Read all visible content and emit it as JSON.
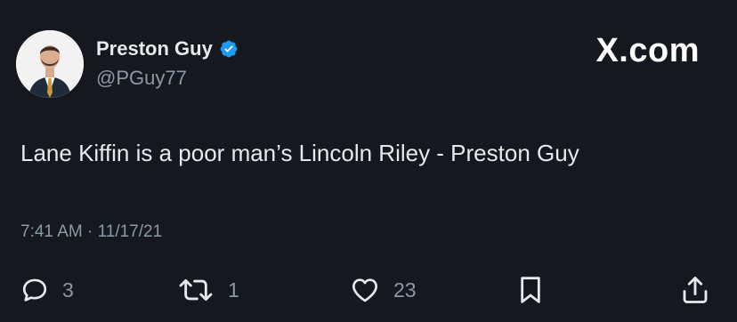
{
  "author": {
    "name": "Preston Guy",
    "handle": "@PGuy77",
    "verified": true,
    "avatar_icon": "person-in-suit-avatar"
  },
  "brand": {
    "label": "X.com"
  },
  "tweet": {
    "text": "Lane Kiffin is a poor man’s Lincoln Riley - Preston Guy",
    "timestamp": "7:41 AM · 11/17/21"
  },
  "actions": {
    "reply": {
      "icon": "reply-icon",
      "count": "3"
    },
    "retweet": {
      "icon": "retweet-icon",
      "count": "1"
    },
    "like": {
      "icon": "heart-icon",
      "count": "23"
    },
    "bookmark": {
      "icon": "bookmark-icon"
    },
    "share": {
      "icon": "share-icon"
    }
  },
  "colors": {
    "background": "#15191f",
    "primary_text": "#e7e9ea",
    "secondary_text": "#8b98a5",
    "verified_badge": "#1d9bf0"
  }
}
